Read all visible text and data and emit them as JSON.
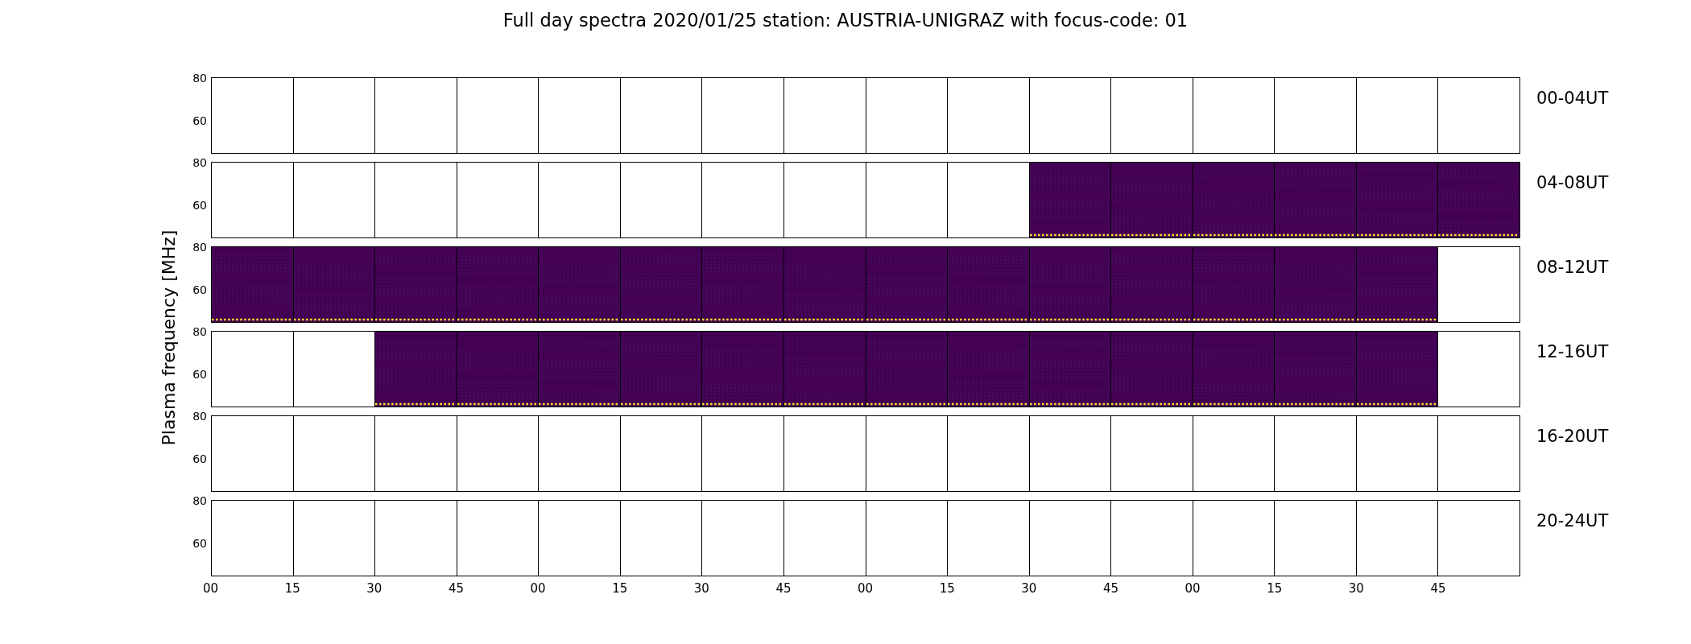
{
  "figure": {
    "title": "Full day spectra 2020/01/25 station: AUSTRIA-UNIGRAZ with focus-code: 01",
    "ylabel": "Plasma frequency [MHz]",
    "rows": [
      {
        "label": "00-04UT",
        "yticks": [
          "80",
          "60"
        ],
        "panels": [
          {
            "has_data": false
          },
          {
            "has_data": false
          },
          {
            "has_data": false
          },
          {
            "has_data": false
          },
          {
            "has_data": false
          },
          {
            "has_data": false
          },
          {
            "has_data": false
          },
          {
            "has_data": false
          },
          {
            "has_data": false
          },
          {
            "has_data": false
          },
          {
            "has_data": false
          },
          {
            "has_data": false
          },
          {
            "has_data": false
          },
          {
            "has_data": false
          },
          {
            "has_data": false
          },
          {
            "has_data": false
          }
        ]
      },
      {
        "label": "04-08UT",
        "yticks": [
          "80",
          "60"
        ],
        "panels": [
          {
            "has_data": false
          },
          {
            "has_data": false
          },
          {
            "has_data": false
          },
          {
            "has_data": false
          },
          {
            "has_data": false
          },
          {
            "has_data": false
          },
          {
            "has_data": false
          },
          {
            "has_data": false
          },
          {
            "has_data": false
          },
          {
            "has_data": false
          },
          {
            "has_data": true
          },
          {
            "has_data": true
          },
          {
            "has_data": true
          },
          {
            "has_data": true
          },
          {
            "has_data": true
          },
          {
            "has_data": true
          }
        ]
      },
      {
        "label": "08-12UT",
        "yticks": [
          "80",
          "60"
        ],
        "panels": [
          {
            "has_data": true
          },
          {
            "has_data": true
          },
          {
            "has_data": true
          },
          {
            "has_data": true
          },
          {
            "has_data": true
          },
          {
            "has_data": true
          },
          {
            "has_data": true
          },
          {
            "has_data": true
          },
          {
            "has_data": true
          },
          {
            "has_data": true
          },
          {
            "has_data": true
          },
          {
            "has_data": true
          },
          {
            "has_data": true
          },
          {
            "has_data": true
          },
          {
            "has_data": true
          },
          {
            "has_data": false
          }
        ]
      },
      {
        "label": "12-16UT",
        "yticks": [
          "80",
          "60"
        ],
        "panels": [
          {
            "has_data": false
          },
          {
            "has_data": false
          },
          {
            "has_data": true
          },
          {
            "has_data": true
          },
          {
            "has_data": true
          },
          {
            "has_data": true
          },
          {
            "has_data": true
          },
          {
            "has_data": true
          },
          {
            "has_data": true
          },
          {
            "has_data": true
          },
          {
            "has_data": true
          },
          {
            "has_data": true
          },
          {
            "has_data": true
          },
          {
            "has_data": true
          },
          {
            "has_data": true
          },
          {
            "has_data": false
          }
        ]
      },
      {
        "label": "16-20UT",
        "yticks": [
          "80",
          "60"
        ],
        "panels": [
          {
            "has_data": false
          },
          {
            "has_data": false
          },
          {
            "has_data": false
          },
          {
            "has_data": false
          },
          {
            "has_data": false
          },
          {
            "has_data": false
          },
          {
            "has_data": false
          },
          {
            "has_data": false
          },
          {
            "has_data": false
          },
          {
            "has_data": false
          },
          {
            "has_data": false
          },
          {
            "has_data": false
          },
          {
            "has_data": false
          },
          {
            "has_data": false
          },
          {
            "has_data": false
          },
          {
            "has_data": false
          }
        ]
      },
      {
        "label": "20-24UT",
        "yticks": [
          "80",
          "60"
        ],
        "panels": [
          {
            "has_data": false
          },
          {
            "has_data": false
          },
          {
            "has_data": false
          },
          {
            "has_data": false
          },
          {
            "has_data": false
          },
          {
            "has_data": false
          },
          {
            "has_data": false
          },
          {
            "has_data": false
          },
          {
            "has_data": false
          },
          {
            "has_data": false
          },
          {
            "has_data": false
          },
          {
            "has_data": false
          },
          {
            "has_data": false
          },
          {
            "has_data": false
          },
          {
            "has_data": false
          },
          {
            "has_data": false
          }
        ]
      }
    ],
    "xticks": [
      "00",
      "15",
      "30",
      "45",
      "00",
      "15",
      "30",
      "45",
      "00",
      "15",
      "30",
      "45",
      "00",
      "15",
      "30",
      "45"
    ]
  }
}
